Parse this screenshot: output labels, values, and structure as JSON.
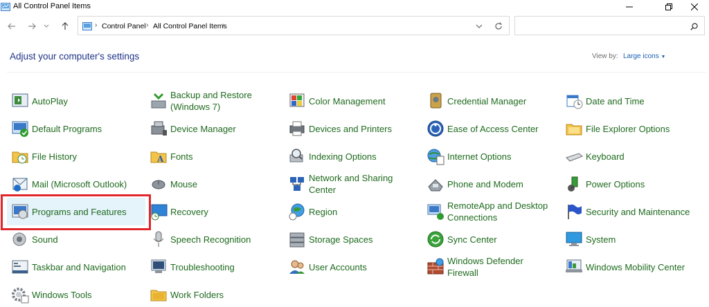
{
  "window": {
    "title": "All Control Panel Items"
  },
  "address": {
    "crumbs": [
      "Control Panel",
      "All Control Panel Items"
    ]
  },
  "search": {
    "placeholder": "",
    "value": ""
  },
  "header": {
    "heading": "Adjust your computer's settings",
    "view_by_label": "View by:",
    "view_by_value": "Large icons"
  },
  "items": [
    {
      "label": "AutoPlay",
      "icon": "autoplay-icon"
    },
    {
      "label": "Backup and Restore\n(Windows 7)",
      "icon": "backup-restore-icon"
    },
    {
      "label": "Color Management",
      "icon": "color-management-icon"
    },
    {
      "label": "Credential Manager",
      "icon": "credential-manager-icon"
    },
    {
      "label": "Date and Time",
      "icon": "date-time-icon"
    },
    {
      "label": "Default Programs",
      "icon": "default-programs-icon"
    },
    {
      "label": "Device Manager",
      "icon": "device-manager-icon"
    },
    {
      "label": "Devices and Printers",
      "icon": "devices-printers-icon"
    },
    {
      "label": "Ease of Access Center",
      "icon": "ease-of-access-icon"
    },
    {
      "label": "File Explorer Options",
      "icon": "folder-options-icon"
    },
    {
      "label": "File History",
      "icon": "file-history-icon"
    },
    {
      "label": "Fonts",
      "icon": "fonts-icon"
    },
    {
      "label": "Indexing Options",
      "icon": "indexing-icon"
    },
    {
      "label": "Internet Options",
      "icon": "internet-options-icon"
    },
    {
      "label": "Keyboard",
      "icon": "keyboard-icon"
    },
    {
      "label": "Mail (Microsoft Outlook)",
      "icon": "mail-icon"
    },
    {
      "label": "Mouse",
      "icon": "mouse-icon"
    },
    {
      "label": "Network and Sharing\nCenter",
      "icon": "network-icon"
    },
    {
      "label": "Phone and Modem",
      "icon": "phone-modem-icon"
    },
    {
      "label": "Power Options",
      "icon": "power-options-icon"
    },
    {
      "label": "Programs and Features",
      "icon": "programs-features-icon"
    },
    {
      "label": "Recovery",
      "icon": "recovery-icon"
    },
    {
      "label": "Region",
      "icon": "region-icon"
    },
    {
      "label": "RemoteApp and Desktop\nConnections",
      "icon": "remoteapp-icon"
    },
    {
      "label": "Security and Maintenance",
      "icon": "security-flag-icon"
    },
    {
      "label": "Sound",
      "icon": "sound-icon"
    },
    {
      "label": "Speech Recognition",
      "icon": "microphone-icon"
    },
    {
      "label": "Storage Spaces",
      "icon": "storage-spaces-icon"
    },
    {
      "label": "Sync Center",
      "icon": "sync-center-icon"
    },
    {
      "label": "System",
      "icon": "system-icon"
    },
    {
      "label": "Taskbar and Navigation",
      "icon": "taskbar-icon"
    },
    {
      "label": "Troubleshooting",
      "icon": "troubleshooting-icon"
    },
    {
      "label": "User Accounts",
      "icon": "user-accounts-icon"
    },
    {
      "label": "Windows Defender\nFirewall",
      "icon": "firewall-icon"
    },
    {
      "label": "Windows Mobility Center",
      "icon": "mobility-center-icon"
    },
    {
      "label": "Windows Tools",
      "icon": "windows-tools-icon"
    },
    {
      "label": "Work Folders",
      "icon": "work-folders-icon"
    }
  ],
  "colors": {
    "link_green": "#1e6a1e",
    "heading_blue": "#1e3287",
    "highlight_red": "#e0262b",
    "selected_bg": "#e5f3fb"
  }
}
